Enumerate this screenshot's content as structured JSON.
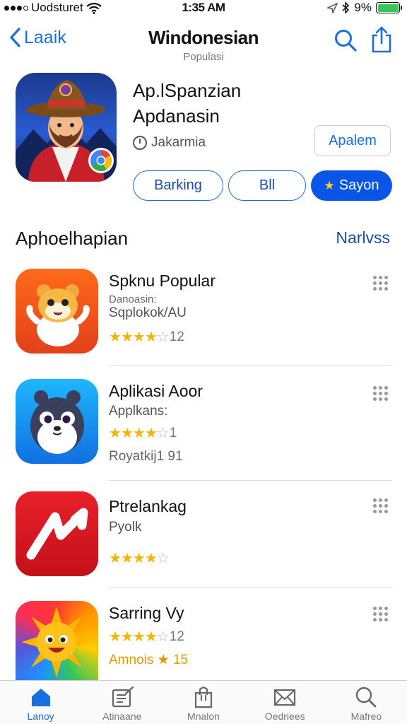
{
  "status_bar": {
    "carrier": "Uodsturet",
    "time": "1:35 AM",
    "battery": "9%",
    "battery_level": 1.0
  },
  "nav": {
    "back_label": "Laaik",
    "title": "Windonesian",
    "subtitle": "Populasi"
  },
  "featured": {
    "name_line1": "Ap.lSpanzian",
    "name_line2": "Apdanasin",
    "developer": "Jakarmia",
    "get_label": "Apalem",
    "pills": [
      "Barking",
      "Bll",
      "Sayon"
    ]
  },
  "section": {
    "title": "Aphoelhapian",
    "link": "Narlvss"
  },
  "apps": [
    {
      "name": "Spknu Popular",
      "subtitle": "Danoasin:",
      "developer": "Sqplokok/AU",
      "rating": 4,
      "rating_label": "12",
      "icon": "hamster-icon"
    },
    {
      "name": "Aplikasi Aoor",
      "subtitle": "Applkans:",
      "rating": 4,
      "rating_label": "1",
      "extra": "Royatkij1 91",
      "icon": "mole-icon"
    },
    {
      "name": "Ptrelankag",
      "subtitle": "Pyolk",
      "rating": 4,
      "rating_label": "",
      "icon": "arrow-icon"
    },
    {
      "name": "Sarring Vy",
      "rating": 4,
      "rating_label": "12",
      "extra": "Amnois ★ 15",
      "icon": "sun-icon"
    }
  ],
  "tabs": [
    {
      "label": "Lanoy",
      "icon": "home-icon",
      "active": true
    },
    {
      "label": "Atinaane",
      "icon": "note-edit-icon",
      "active": false
    },
    {
      "label": "Mnalon",
      "icon": "bag-icon",
      "active": false
    },
    {
      "label": "Oedriees",
      "icon": "mail-icon",
      "active": false
    },
    {
      "label": "Mafreo",
      "icon": "search-icon",
      "active": false
    }
  ],
  "colors": {
    "accent": "#1a6fe0",
    "primary_button": "#0a55e8",
    "star": "#f5b300"
  }
}
